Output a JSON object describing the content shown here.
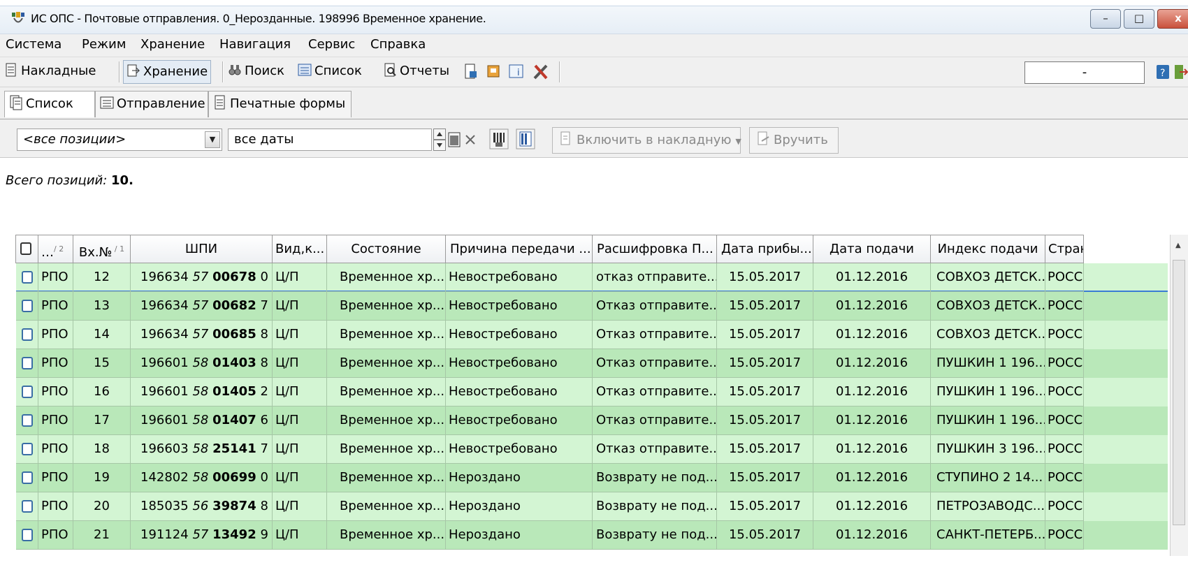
{
  "window": {
    "title": "ИС ОПС - Почтовые отправления. 0_Нерозданные. 198996 Временное хранение.",
    "minimize_glyph": "–",
    "maximize_glyph": "□",
    "close_glyph": "x"
  },
  "menu": [
    "Система",
    "Режим",
    "Хранение",
    "Навигация",
    "Сервис",
    "Справка"
  ],
  "toolbar": {
    "nakladnye": "Накладные",
    "hranenie": "Хранение",
    "poisk": "Поиск",
    "spisok": "Список",
    "otchety": "Отчеты",
    "field_value": "-"
  },
  "subtabs": {
    "spisok": "Список",
    "otpravlenie": "Отправление",
    "pechatnye": "Печатные формы"
  },
  "filter": {
    "positions_value": "<все позиции>",
    "dates_value": "все даты",
    "include_button": "Включить в накладную",
    "deliver_button": "Вручить"
  },
  "info": {
    "label": "Всего позиций:",
    "count": "10."
  },
  "table": {
    "headers": [
      "…",
      "Вх.№",
      "ШПИ",
      "Вид,к...",
      "Состояние",
      "Причина передачи ...",
      "Расшифровка П...",
      "Дата прибы...",
      "Дата подачи",
      "Индекс подачи",
      "Стран"
    ],
    "sort1": "2",
    "sort2": "1",
    "rows": [
      {
        "type": "РПО",
        "num": "12",
        "spi_a": "196634",
        "spi_b": "57",
        "spi_c": "00678",
        "spi_d": "0",
        "vid": "Ц/П",
        "state": "Временное хр...",
        "reason": "Невостребовано",
        "decode": "отказ отправите...",
        "arrival": "15.05.2017",
        "sent": "01.12.2016",
        "index": "СОВХОЗ ДЕТСК...",
        "country": "РОСС"
      },
      {
        "type": "РПО",
        "num": "13",
        "spi_a": "196634",
        "spi_b": "57",
        "spi_c": "00682",
        "spi_d": "7",
        "vid": "Ц/П",
        "state": "Временное хр...",
        "reason": "Невостребовано",
        "decode": "Отказ отправите...",
        "arrival": "15.05.2017",
        "sent": "01.12.2016",
        "index": "СОВХОЗ ДЕТСК...",
        "country": "РОСС"
      },
      {
        "type": "РПО",
        "num": "14",
        "spi_a": "196634",
        "spi_b": "57",
        "spi_c": "00685",
        "spi_d": "8",
        "vid": "Ц/П",
        "state": "Временное хр...",
        "reason": "Невостребовано",
        "decode": "Отказ отправите...",
        "arrival": "15.05.2017",
        "sent": "01.12.2016",
        "index": "СОВХОЗ ДЕТСК...",
        "country": "РОСС"
      },
      {
        "type": "РПО",
        "num": "15",
        "spi_a": "196601",
        "spi_b": "58",
        "spi_c": "01403",
        "spi_d": "8",
        "vid": "Ц/П",
        "state": "Временное хр...",
        "reason": "Невостребовано",
        "decode": "Отказ отправите...",
        "arrival": "15.05.2017",
        "sent": "01.12.2016",
        "index": "ПУШКИН 1 196...",
        "country": "РОСС"
      },
      {
        "type": "РПО",
        "num": "16",
        "spi_a": "196601",
        "spi_b": "58",
        "spi_c": "01405",
        "spi_d": "2",
        "vid": "Ц/П",
        "state": "Временное хр...",
        "reason": "Невостребовано",
        "decode": "Отказ отправите...",
        "arrival": "15.05.2017",
        "sent": "01.12.2016",
        "index": "ПУШКИН 1 196...",
        "country": "РОСС"
      },
      {
        "type": "РПО",
        "num": "17",
        "spi_a": "196601",
        "spi_b": "58",
        "spi_c": "01407",
        "spi_d": "6",
        "vid": "Ц/П",
        "state": "Временное хр...",
        "reason": "Невостребовано",
        "decode": "Отказ отправите...",
        "arrival": "15.05.2017",
        "sent": "01.12.2016",
        "index": "ПУШКИН 1 196...",
        "country": "РОСС"
      },
      {
        "type": "РПО",
        "num": "18",
        "spi_a": "196603",
        "spi_b": "58",
        "spi_c": "25141",
        "spi_d": "7",
        "vid": "Ц/П",
        "state": "Временное хр...",
        "reason": "Невостребовано",
        "decode": "Отказ отправите...",
        "arrival": "15.05.2017",
        "sent": "01.12.2016",
        "index": "ПУШКИН 3 196...",
        "country": "РОСС"
      },
      {
        "type": "РПО",
        "num": "19",
        "spi_a": "142802",
        "spi_b": "58",
        "spi_c": "00699",
        "spi_d": "0",
        "vid": "Ц/П",
        "state": "Временное хр...",
        "reason": "Нероздано",
        "decode": "Возврату не под...",
        "arrival": "15.05.2017",
        "sent": "01.12.2016",
        "index": "СТУПИНО 2 14...",
        "country": "РОСС"
      },
      {
        "type": "РПО",
        "num": "20",
        "spi_a": "185035",
        "spi_b": "56",
        "spi_c": "39874",
        "spi_d": "8",
        "vid": "Ц/П",
        "state": "Временное хр...",
        "reason": "Нероздано",
        "decode": "Возврату не под...",
        "arrival": "15.05.2017",
        "sent": "01.12.2016",
        "index": "ПЕТРОЗАВОДС...",
        "country": "РОСС"
      },
      {
        "type": "РПО",
        "num": "21",
        "spi_a": "191124",
        "spi_b": "57",
        "spi_c": "13492",
        "spi_d": "9",
        "vid": "Ц/П",
        "state": "Временное хр...",
        "reason": "Нероздано",
        "decode": "Возврату не под...",
        "arrival": "15.05.2017",
        "sent": "01.12.2016",
        "index": "САНКТ-ПЕТЕРБ...",
        "country": "РОСС"
      }
    ]
  },
  "colors": {
    "row_light": "#d3f5d3",
    "row_dark": "#b9e8b9",
    "selected_row_line": "#3a7bd5"
  }
}
